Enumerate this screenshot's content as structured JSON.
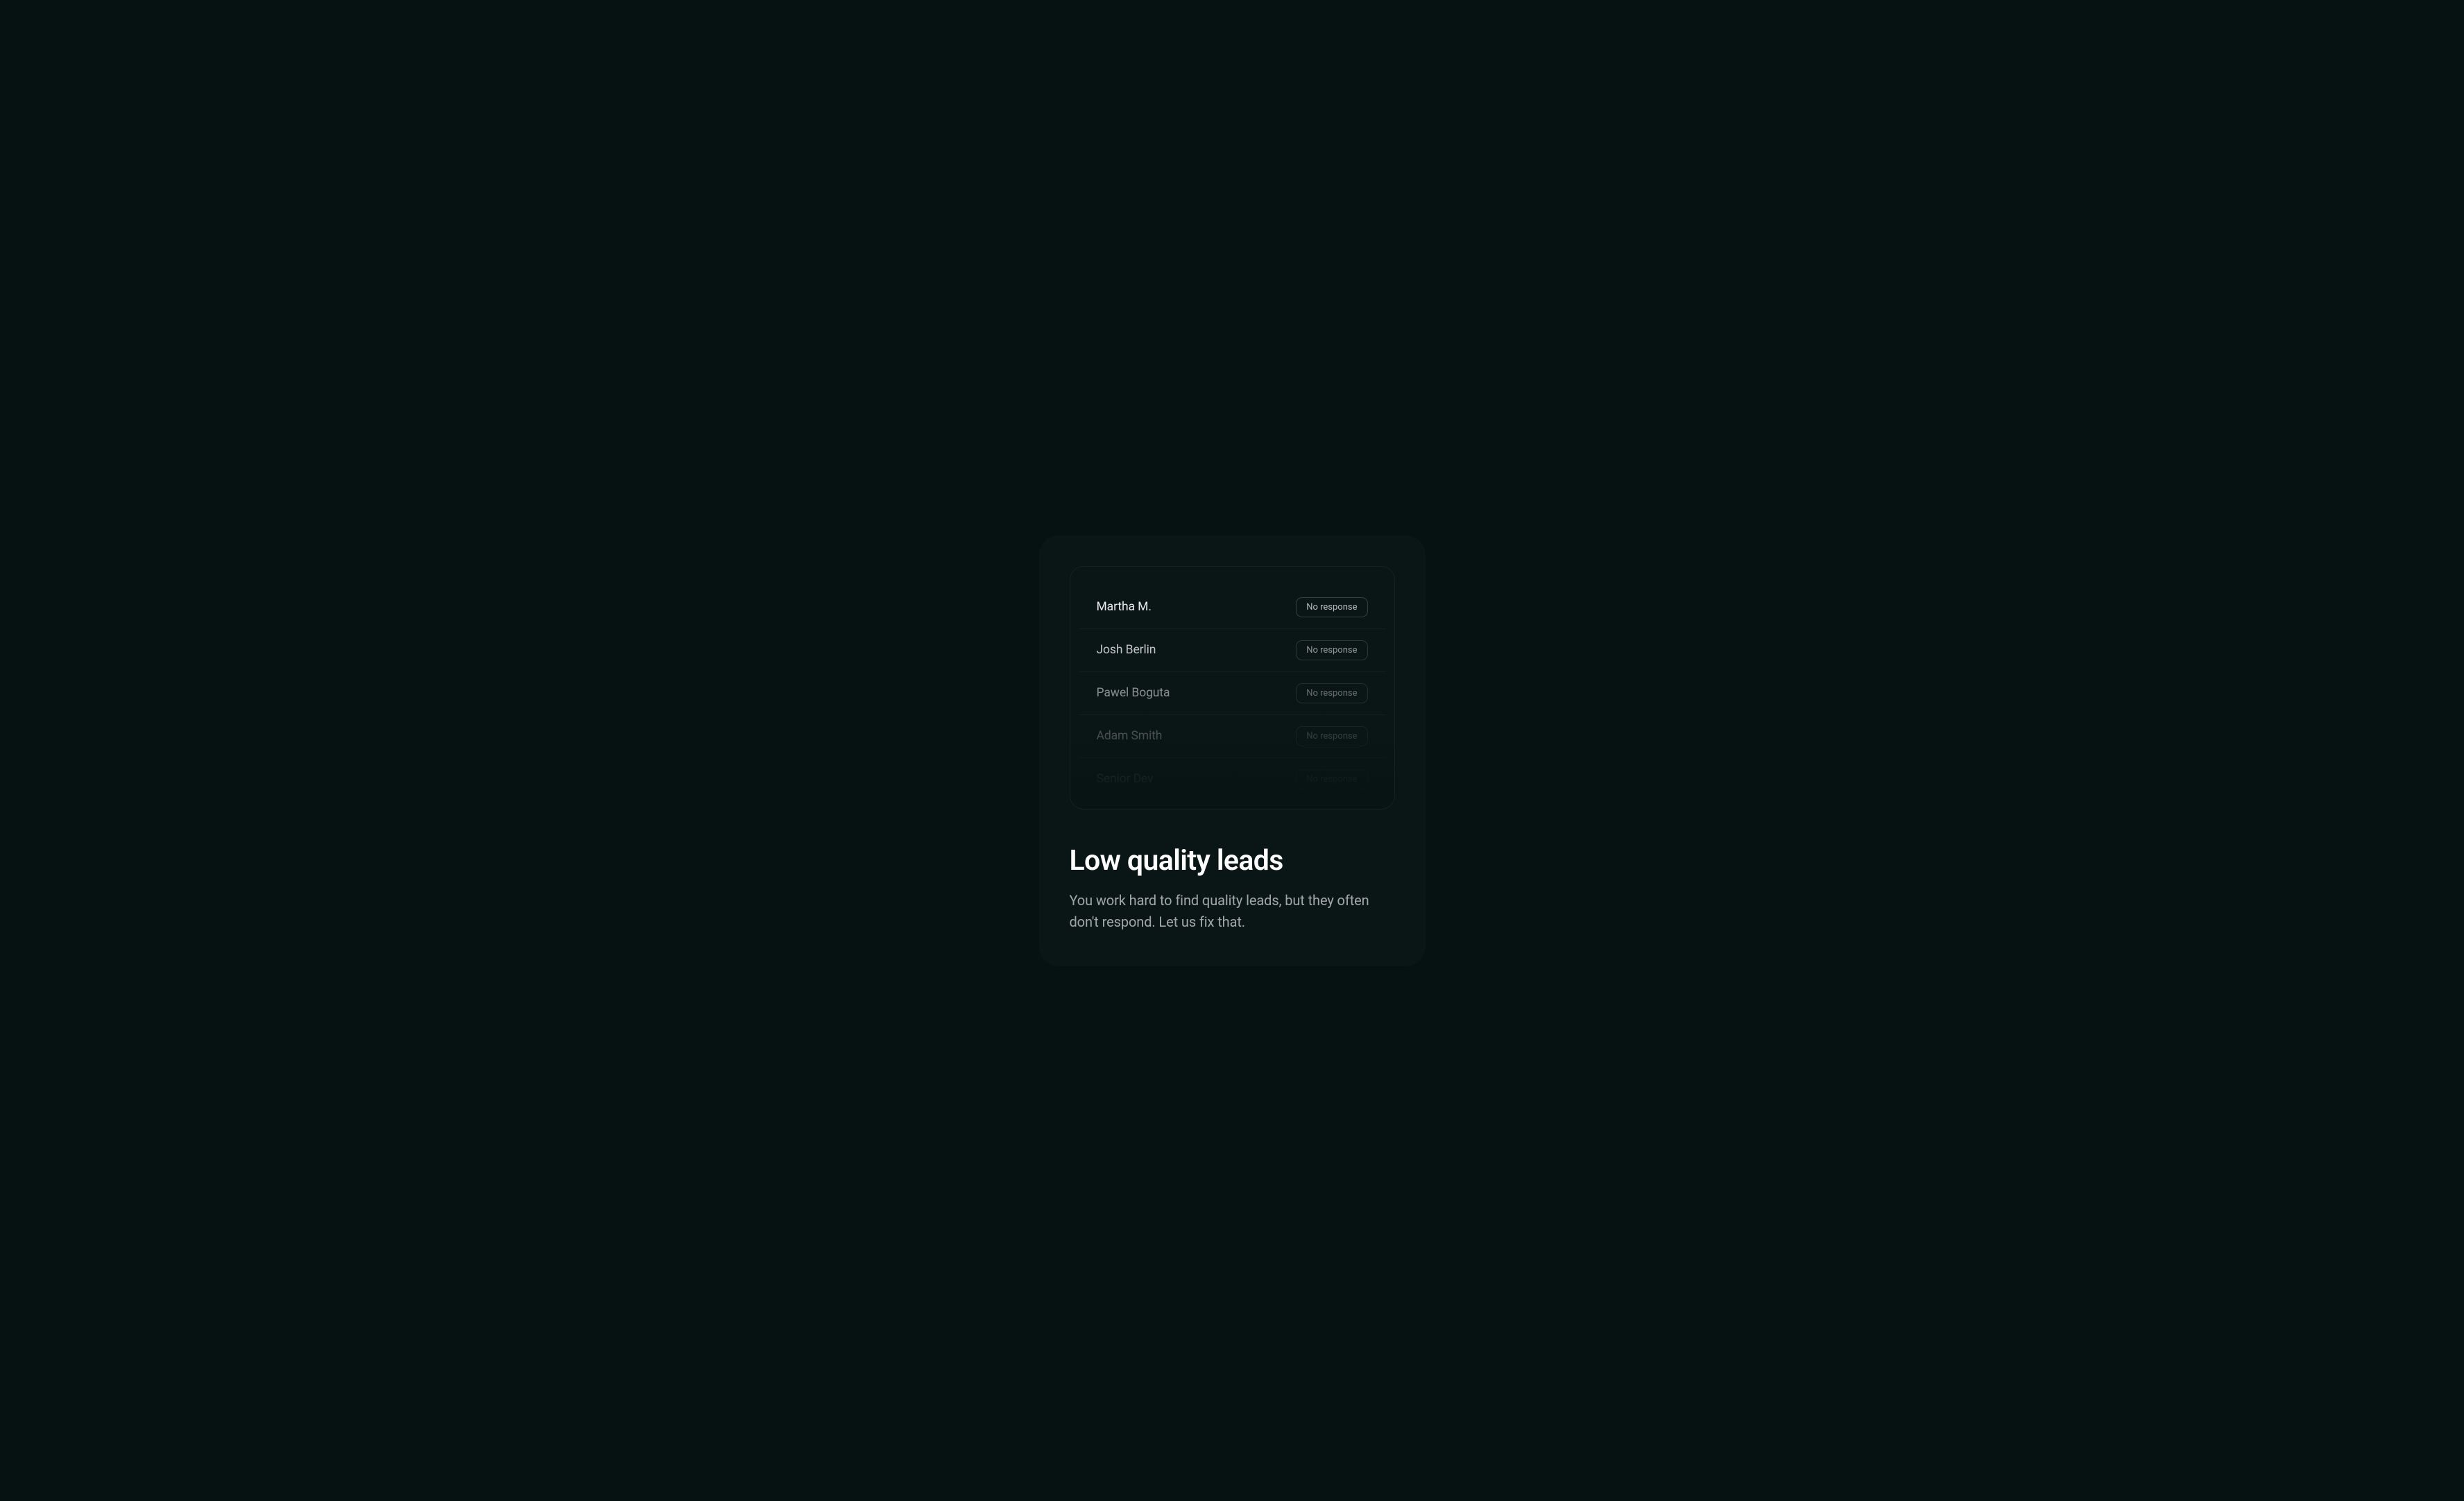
{
  "card": {
    "heading": "Low quality leads",
    "subtext": "You work hard to find quality leads, but they often don't respond. Let us fix that."
  },
  "leads": [
    {
      "name": "Martha M.",
      "status": "No response"
    },
    {
      "name": "Josh Berlin",
      "status": "No response"
    },
    {
      "name": "Pawel Boguta",
      "status": "No response"
    },
    {
      "name": "Adam Smith",
      "status": "No response"
    },
    {
      "name": "Senior Dev",
      "status": "No response"
    }
  ]
}
